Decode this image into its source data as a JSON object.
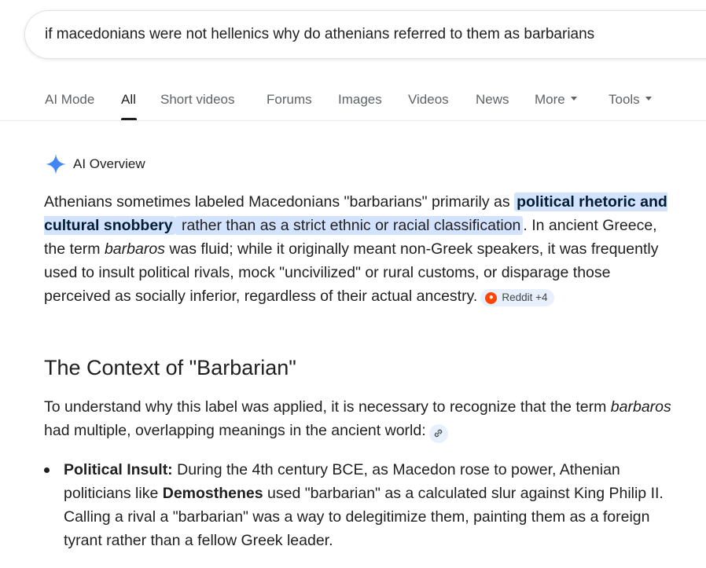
{
  "search": {
    "query": "if macedonians were not hellenics why do athenians referred to them as barbarians"
  },
  "tabs": [
    {
      "label": "AI Mode"
    },
    {
      "label": "All"
    },
    {
      "label": "Short videos"
    },
    {
      "label": "Forums"
    },
    {
      "label": "Images"
    },
    {
      "label": "Videos"
    },
    {
      "label": "News"
    },
    {
      "label": "More"
    },
    {
      "label": "Tools"
    }
  ],
  "ai_overview": {
    "title": "AI Overview",
    "intro_part1": "Athenians sometimes labeled Macedonians \"barbarians\" primarily as ",
    "highlight_bold": "political rhetoric and cultural snobbery",
    "highlight_rest": " rather than as a strict ethnic or racial classification",
    "intro_part2": ". In ancient Greece, the term ",
    "term": "barbaros",
    "intro_part3": " was fluid; while it originally meant non-Greek speakers, it was frequently used to insult political rivals, mock \"uncivilized\" or rural customs, or disparage those perceived as socially inferior, regardless of their actual ancestry.",
    "source_chip": "Reddit +4",
    "colors": {
      "highlight": "#d3e3fd",
      "sparkle": "#4285f4",
      "reddit": "#ff4500"
    }
  },
  "context": {
    "heading": "The Context of \"Barbarian\"",
    "para_part1": "To understand why this label was applied, it is necessary to recognize that the term ",
    "term": "barbaros",
    "para_part2": " had multiple, overlapping meanings in the ancient world:",
    "bullets": [
      {
        "label": "Political Insult:",
        "part1": " During the 4th century BCE, as Macedon rose to power, Athenian politicians like ",
        "bold": "Demosthenes",
        "part2": " used \"barbarian\" as a calculated slur against King Philip II. Calling a rival a \"barbarian\" was a way to delegitimize them, painting them as a foreign tyrant rather than a fellow Greek leader."
      }
    ]
  }
}
